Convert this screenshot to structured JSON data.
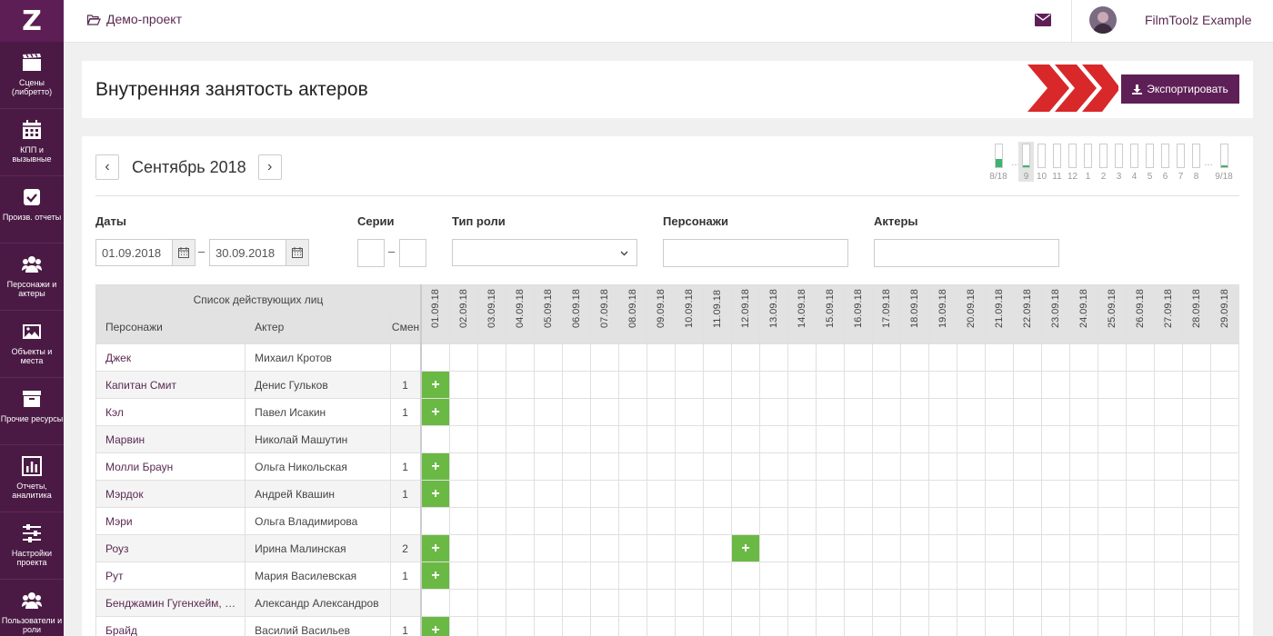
{
  "sidebar": {
    "logo": "Z",
    "items": [
      {
        "label": "Сцены (либретто)",
        "icon": "clapperboard-icon"
      },
      {
        "label": "КПП и вызывные",
        "icon": "calendar-icon"
      },
      {
        "label": "Произв. отчеты",
        "icon": "checkbox-icon"
      },
      {
        "label": "Персонажи и актеры",
        "icon": "users-icon"
      },
      {
        "label": "Объекты и места",
        "icon": "image-icon"
      },
      {
        "label": "Прочие ресурсы",
        "icon": "archive-icon"
      },
      {
        "label": "Отчеты, аналитика",
        "icon": "bar-chart-icon"
      },
      {
        "label": "Настройки проекта",
        "icon": "sliders-icon"
      },
      {
        "label": "Пользователи и роли",
        "icon": "user-group-icon"
      }
    ]
  },
  "topbar": {
    "project": "Демо-проект",
    "user_name": "FilmToolz Example"
  },
  "header": {
    "title": "Внутренняя занятость актеров",
    "export_label": "Экспортировать"
  },
  "calendar": {
    "month": "Сентябрь 2018",
    "prev": "‹",
    "next": "›",
    "mini": [
      {
        "label": "8/18",
        "fill": 0.35,
        "wide": true
      },
      {
        "dots": "…"
      },
      {
        "label": "9",
        "fill": 0.08,
        "active": true
      },
      {
        "label": "10",
        "fill": 0
      },
      {
        "label": "11",
        "fill": 0
      },
      {
        "label": "12",
        "fill": 0
      },
      {
        "label": "1",
        "fill": 0
      },
      {
        "label": "2",
        "fill": 0
      },
      {
        "label": "3",
        "fill": 0
      },
      {
        "label": "4",
        "fill": 0
      },
      {
        "label": "5",
        "fill": 0
      },
      {
        "label": "6",
        "fill": 0
      },
      {
        "label": "7",
        "fill": 0
      },
      {
        "label": "8",
        "fill": 0
      },
      {
        "dots": "…"
      },
      {
        "label": "9/18",
        "fill": 0.08,
        "wide": true
      }
    ]
  },
  "filters": {
    "dates_label": "Даты",
    "date_from": "01.09.2018",
    "date_to": "30.09.2018",
    "series_label": "Серии",
    "role_type_label": "Тип роли",
    "characters_label": "Персонажи",
    "actors_label": "Актеры",
    "dash": "–"
  },
  "table": {
    "group_header": "Список действующих лиц",
    "col_character": "Персонажи",
    "col_actor": "Актер",
    "col_shifts": "Смен",
    "dates": [
      "01.09.18",
      "02.09.18",
      "03.09.18",
      "04.09.18",
      "05.09.18",
      "06.09.18",
      "07.09.18",
      "08.09.18",
      "09.09.18",
      "10.09.18",
      "11.09.18",
      "12.09.18",
      "13.09.18",
      "14.09.18",
      "15.09.18",
      "16.09.18",
      "17.09.18",
      "18.09.18",
      "19.09.18",
      "20.09.18",
      "21.09.18",
      "22.09.18",
      "23.09.18",
      "24.09.18",
      "25.09.18",
      "26.09.18",
      "27.09.18",
      "28.09.18",
      "29.09.18"
    ],
    "busy_mark": "+",
    "rows": [
      {
        "character": "Джек",
        "actor": "Михаил Кротов",
        "shifts": "",
        "busy": []
      },
      {
        "character": "Капитан Смит",
        "actor": "Денис Гульков",
        "shifts": "1",
        "busy": [
          0
        ]
      },
      {
        "character": "Кэл",
        "actor": "Павел Исакин",
        "shifts": "1",
        "busy": [
          0
        ]
      },
      {
        "character": "Марвин",
        "actor": "Николай Машутин",
        "shifts": "",
        "busy": []
      },
      {
        "character": "Молли Браун",
        "actor": "Ольга Никольская",
        "shifts": "1",
        "busy": [
          0
        ]
      },
      {
        "character": "Мэрдок",
        "actor": "Андрей Квашин",
        "shifts": "1",
        "busy": [
          0
        ]
      },
      {
        "character": "Мэри",
        "actor": "Ольга Владимирова",
        "shifts": "",
        "busy": []
      },
      {
        "character": "Роуз",
        "actor": "Ирина Малинская",
        "shifts": "2",
        "busy": [
          0,
          11
        ]
      },
      {
        "character": "Рут",
        "actor": "Мария Василевская",
        "shifts": "1",
        "busy": [
          0
        ]
      },
      {
        "character": "Бенджамин Гугенхейм, …",
        "actor": "Александр Александров",
        "shifts": "",
        "busy": []
      },
      {
        "character": "Брайд",
        "actor": "Василий Васильев",
        "shifts": "1",
        "busy": [
          0
        ]
      }
    ]
  }
}
